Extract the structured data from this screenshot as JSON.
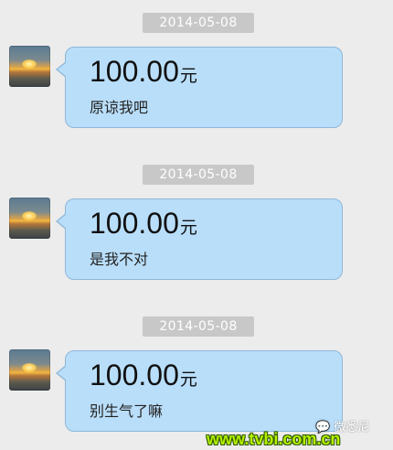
{
  "messages": [
    {
      "date": "2014-05-08",
      "amount": "100.00",
      "unit": "元",
      "note": "原谅我吧"
    },
    {
      "date": "2014-05-08",
      "amount": "100.00",
      "unit": "元",
      "note": "是我不对"
    },
    {
      "date": "2014-05-08",
      "amount": "100.00",
      "unit": "元",
      "note": "别生气了嘛"
    }
  ],
  "watermark": {
    "logo_text": "微悉尼",
    "url": "www.tvbi.com.cn"
  },
  "colors": {
    "background": "#ececec",
    "bubble": "#b9defa",
    "bubble_border": "#8db7d9",
    "date_chip": "#c8c8c8",
    "watermark_url": "#b7f000"
  },
  "icons": {
    "avatar": "sunset-avatar"
  }
}
